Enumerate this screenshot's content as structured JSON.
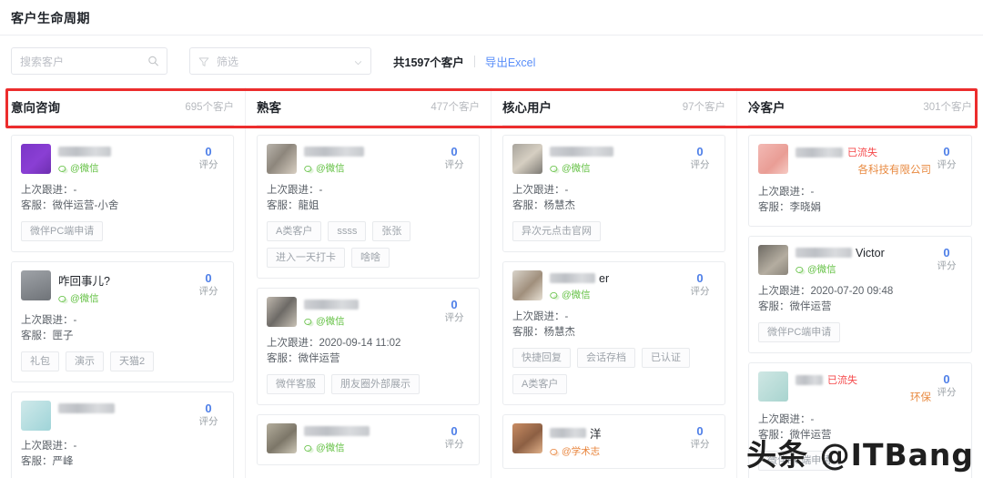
{
  "header": {
    "title": "客户生命周期"
  },
  "toolbar": {
    "search_placeholder": "搜索客户",
    "search_value": "",
    "filter_placeholder": "筛选",
    "filter_value": "",
    "total_count_text": "共1597个客户",
    "export_label": "导出Excel",
    "icons": {
      "search": "search-icon",
      "filter": "filter-icon",
      "chevron": "chevron-down-icon"
    }
  },
  "board": {
    "columns": [
      {
        "name": "意向咨询",
        "count_text": "695个客户",
        "cards": [
          {
            "name": "",
            "name_blurred": true,
            "name_width": 58,
            "avatar_style": "av-purple",
            "channel": "@微信",
            "channel_color": "green",
            "score": "0",
            "score_label": "评分",
            "last_follow": "上次跟进：-",
            "agent": "客服：微伴运营-小舍",
            "tags": [
              "微伴PC端申请"
            ]
          },
          {
            "name": "咋回事儿?",
            "name_blurred": false,
            "avatar_style": "av-gray",
            "channel": "@微信",
            "channel_color": "green",
            "score": "0",
            "score_label": "评分",
            "last_follow": "上次跟进：-",
            "agent": "客服：匣子",
            "tags": [
              "礼包",
              "演示",
              "天猫2"
            ]
          },
          {
            "name": "",
            "name_blurred": true,
            "name_width": 62,
            "avatar_style": "av-teal",
            "channel": "",
            "channel_color": "green",
            "score": "0",
            "score_label": "评分",
            "last_follow": "上次跟进：-",
            "agent": "客服：严峰",
            "tags": []
          }
        ]
      },
      {
        "name": "熟客",
        "count_text": "477个客户",
        "cards": [
          {
            "name": "",
            "name_blurred": true,
            "name_width": 66,
            "avatar_style": "av-photo",
            "channel": "@微信",
            "channel_color": "green",
            "score": "0",
            "score_label": "评分",
            "last_follow": "上次跟进：-",
            "agent": "客服：龍姐",
            "tags": [
              "A类客户",
              "ssss",
              "张张",
              "进入一天打卡",
              "啥啥"
            ]
          },
          {
            "name": "",
            "name_blurred": true,
            "name_width": 60,
            "avatar_style": "av-photo2",
            "channel": "@微信",
            "channel_color": "green",
            "score": "0",
            "score_label": "评分",
            "last_follow": "上次跟进：2020-09-14 11:02",
            "agent": "客服：微伴运营",
            "tags": [
              "微伴客服",
              "朋友圈外部展示"
            ]
          },
          {
            "name": "",
            "name_blurred": true,
            "name_width": 72,
            "avatar_style": "av-olive",
            "channel": "@微信",
            "channel_color": "green",
            "score": "0",
            "score_label": "评分",
            "last_follow": "",
            "agent": "",
            "tags": []
          }
        ]
      },
      {
        "name": "核心用户",
        "count_text": "97个客户",
        "cards": [
          {
            "name": "",
            "name_blurred": true,
            "name_width": 70,
            "avatar_style": "av-photo3",
            "channel": "@微信",
            "channel_color": "green",
            "score": "0",
            "score_label": "评分",
            "last_follow": "上次跟进：-",
            "agent": "客服：杨慧杰",
            "tags": [
              "异次元点击官网"
            ]
          },
          {
            "name": "er",
            "name_blurred": true,
            "name_width": 50,
            "avatar_style": "av-warm",
            "channel": "@微信",
            "channel_color": "green",
            "score": "0",
            "score_label": "评分",
            "last_follow": "上次跟进：-",
            "agent": "客服：杨慧杰",
            "tags": [
              "快捷回复",
              "会话存档",
              "已认证",
              "A类客户"
            ]
          },
          {
            "name": "洋",
            "name_blurred": true,
            "name_width": 40,
            "avatar_style": "av-orange",
            "channel": "@学术志",
            "channel_color": "orange",
            "score": "0",
            "score_label": "评分",
            "last_follow": "",
            "agent": "",
            "tags": []
          }
        ]
      },
      {
        "name": "冷客户",
        "count_text": "301个客户",
        "cards": [
          {
            "name": "",
            "name_blurred": true,
            "name_width": 52,
            "avatar_style": "av-pink",
            "lost_badge": "已流失",
            "corp_name": "各科技有限公司",
            "channel": "",
            "channel_color": "green",
            "score": "0",
            "score_label": "评分",
            "last_follow": "上次跟进：-",
            "agent": "客服：李晓娟",
            "tags": []
          },
          {
            "name": "Victor",
            "name_blurred": true,
            "name_width": 62,
            "avatar_style": "av-dark",
            "channel": "@微信",
            "channel_color": "green",
            "score": "0",
            "score_label": "评分",
            "last_follow": "上次跟进：2020-07-20 09:48",
            "agent": "客服：微伴运营",
            "tags": [
              "微伴PC端申请"
            ]
          },
          {
            "name": "",
            "name_blurred": true,
            "name_width": 30,
            "avatar_style": "av-mint",
            "lost_badge": "已流失",
            "corp_name": "环保",
            "channel": "",
            "channel_color": "green",
            "score": "0",
            "score_label": "评分",
            "last_follow": "上次跟进：-",
            "agent": "客服：微伴运营",
            "tags": [
              "微伴PC端申请"
            ]
          }
        ]
      }
    ]
  },
  "annotation": {
    "color": "#ec2d2d"
  },
  "watermark": {
    "text": "头条 @ITBang"
  }
}
